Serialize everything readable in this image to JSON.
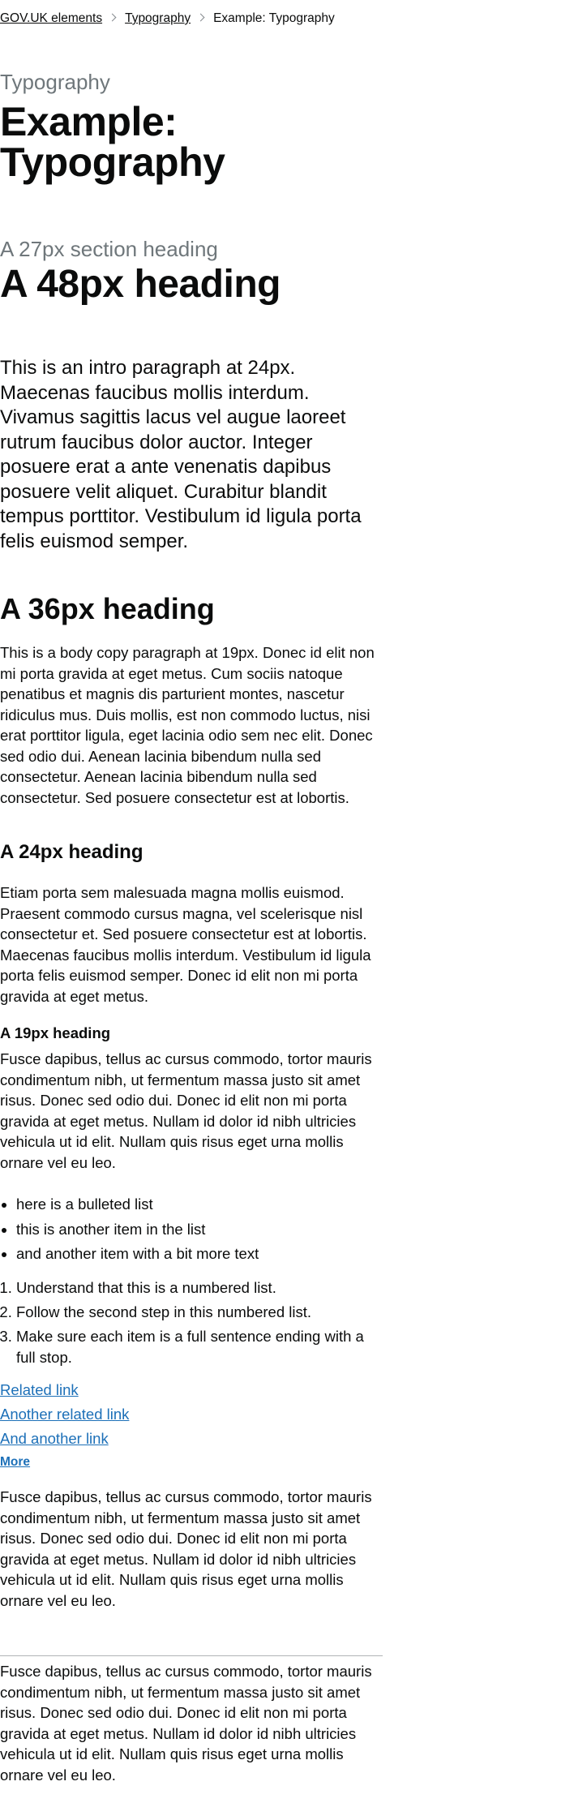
{
  "breadcrumbs": [
    {
      "label": "GOV.UK elements",
      "link": true
    },
    {
      "label": "Typography",
      "link": true
    },
    {
      "label": "Example: Typography",
      "link": false
    }
  ],
  "page": {
    "caption": "Typography",
    "title_line1": "Example:",
    "title_line2": "Typography"
  },
  "section": {
    "caption": "A 27px section heading",
    "heading": "A 48px heading"
  },
  "intro": "This is an intro paragraph at 24px. Maecenas faucibus mollis interdum. Vivamus sagittis lacus vel augue laoreet rutrum faucibus dolor auctor. Integer posuere erat a ante venenatis dapibus posuere velit aliquet. Curabitur blandit tempus porttitor. Vestibulum id ligula porta felis euismod semper.",
  "h36": {
    "heading": "A 36px heading",
    "body": "This is a body copy paragraph at 19px. Donec id elit non mi porta gravida at eget metus. Cum sociis natoque penatibus et magnis dis parturient montes, nascetur ridiculus mus. Duis mollis, est non commodo luctus, nisi erat porttitor ligula, eget lacinia odio sem nec elit. Donec sed odio dui. Aenean lacinia bibendum nulla sed consectetur. Aenean lacinia bibendum nulla sed consectetur. Sed posuere consectetur est at lobortis."
  },
  "h24": {
    "heading": "A 24px heading",
    "body": "Etiam porta sem malesuada magna mollis euismod. Praesent commodo cursus magna, vel scelerisque nisl consectetur et. Sed posuere consectetur est at lobortis. Maecenas faucibus mollis interdum. Vestibulum id ligula porta felis euismod semper. Donec id elit non mi porta gravida at eget metus."
  },
  "h19": {
    "heading": "A 19px heading",
    "body": "Fusce dapibus, tellus ac cursus commodo, tortor mauris condimentum nibh, ut fermentum massa justo sit amet risus. Donec sed odio dui. Donec id elit non mi porta gravida at eget metus. Nullam id dolor id nibh ultricies vehicula ut id elit. Nullam quis risus eget urna mollis ornare vel eu leo."
  },
  "bullets": [
    "here is a bulleted list",
    "this is another item in the list",
    "and another item with a bit more text"
  ],
  "numbers": [
    "Understand that this is a numbered list.",
    "Follow the second step in this numbered list.",
    "Make sure each item is a full sentence ending with a full stop."
  ],
  "links": {
    "related": "Related link",
    "another": "Another related link",
    "and_another": "And another link",
    "more": "More"
  },
  "para_after_links": "Fusce dapibus, tellus ac cursus commodo, tortor mauris condimentum nibh, ut fermentum massa justo sit amet risus. Donec sed odio dui. Donec id elit non mi porta gravida at eget metus. Nullam id dolor id nibh ultricies vehicula ut id elit. Nullam quis risus eget urna mollis ornare vel eu leo.",
  "para_after_rule": "Fusce dapibus, tellus ac cursus commodo, tortor mauris condimentum nibh, ut fermentum massa justo sit amet risus. Donec sed odio dui. Donec id elit non mi porta gravida at eget metus. Nullam id dolor id nibh ultricies vehicula ut id elit. Nullam quis risus eget urna mollis ornare vel eu leo.",
  "colors": {
    "text": "#0b0c0c",
    "secondary_text": "#6f777b",
    "link": "#1d70b8",
    "rule": "#b1b4b6"
  }
}
